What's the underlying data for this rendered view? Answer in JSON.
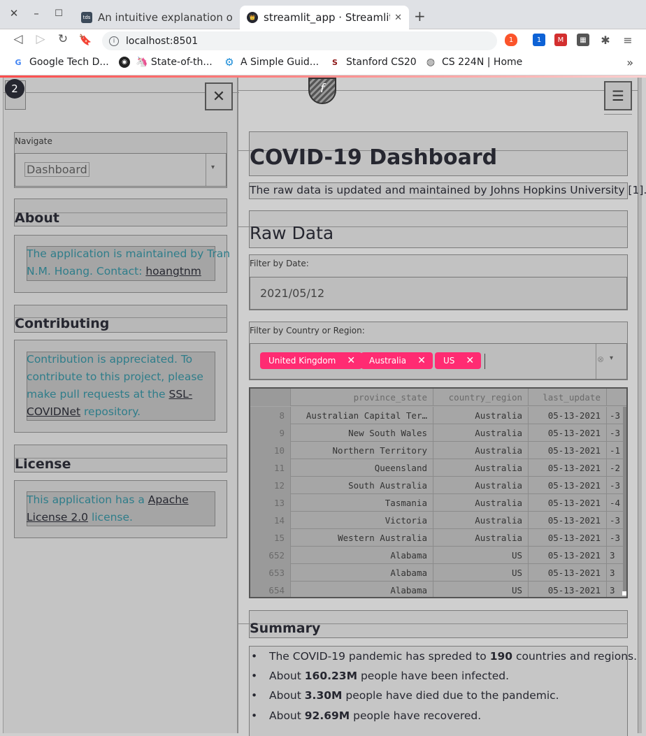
{
  "browser": {
    "tabs": [
      {
        "label": "An intuitive explanation of Be",
        "favicon": "tds",
        "active": false
      },
      {
        "label": "streamlit_app · Streamlit",
        "active": true
      }
    ],
    "url": "localhost:8501",
    "extension_badges": [
      "1",
      "1"
    ],
    "bookmarks": [
      {
        "label": "Google Tech D...",
        "icon": "google-icon"
      },
      {
        "label": "🦄 State-of-th...",
        "icon": "github-icon"
      },
      {
        "label": "A Simple Guid...",
        "icon": "gear-icon"
      },
      {
        "label": "Stanford CS20",
        "icon": "stanford-icon"
      },
      {
        "label": "CS 224N | Home",
        "icon": "globe-icon"
      }
    ]
  },
  "app": {
    "sidebar_badge": "2",
    "logo_letter": "f",
    "sidebar": {
      "navigate_label": "Navigate",
      "navigate_value": "Dashboard",
      "about_heading": "About",
      "about_text_line1": "The application is maintained by Tran",
      "about_text_line2_prefix": "N.M. Hoang. Contact: ",
      "about_link": "hoangtnm",
      "contrib_heading": "Contributing",
      "contrib_line1": "Contribution is appreciated. To",
      "contrib_line2": "contribute to this project, please",
      "contrib_line3_prefix": "make pull requests at the ",
      "contrib_link_part1": "SSL-",
      "contrib_link_part2": "COVIDNet",
      "contrib_line4_suffix": " repository.",
      "license_heading": "License",
      "license_line1_prefix": "This application has a ",
      "license_link_part1": "Apache",
      "license_link_part2": "License 2.0",
      "license_line2_suffix": " license."
    },
    "main": {
      "title": "COVID-19 Dashboard",
      "subtitle": "The raw data is updated and maintained by Johns Hopkins University [1].",
      "raw_data_heading": "Raw Data",
      "date_filter_label": "Filter by Date:",
      "date_value": "2021/05/12",
      "country_filter_label": "Filter by Country or Region:",
      "selected_countries": [
        "United Kingdom",
        "Australia",
        "US"
      ],
      "table": {
        "columns": [
          "",
          "province_state",
          "country_region",
          "last_update",
          ""
        ],
        "rows": [
          [
            "8",
            "Australian Capital Ter…",
            "Australia",
            "05-13-2021",
            "-3"
          ],
          [
            "9",
            "New South Wales",
            "Australia",
            "05-13-2021",
            "-3"
          ],
          [
            "10",
            "Northern Territory",
            "Australia",
            "05-13-2021",
            "-1"
          ],
          [
            "11",
            "Queensland",
            "Australia",
            "05-13-2021",
            "-2"
          ],
          [
            "12",
            "South Australia",
            "Australia",
            "05-13-2021",
            "-3"
          ],
          [
            "13",
            "Tasmania",
            "Australia",
            "05-13-2021",
            "-4"
          ],
          [
            "14",
            "Victoria",
            "Australia",
            "05-13-2021",
            "-3"
          ],
          [
            "15",
            "Western Australia",
            "Australia",
            "05-13-2021",
            "-3"
          ],
          [
            "652",
            "Alabama",
            "US",
            "05-13-2021",
            "3"
          ],
          [
            "653",
            "Alabama",
            "US",
            "05-13-2021",
            "3"
          ],
          [
            "654",
            "Alabama",
            "US",
            "05-13-2021",
            "3"
          ]
        ]
      },
      "summary_heading": "Summary",
      "summary": [
        {
          "pre": "The COVID-19 pandemic has spreded to ",
          "bold": "190",
          "post": " countries and regions."
        },
        {
          "pre": "About ",
          "bold": "160.23M",
          "post": " people have been infected."
        },
        {
          "pre": "About ",
          "bold": "3.30M",
          "post": " people have died due to the pandemic."
        },
        {
          "pre": "About ",
          "bold": "92.69M",
          "post": " people have recovered."
        }
      ]
    }
  }
}
